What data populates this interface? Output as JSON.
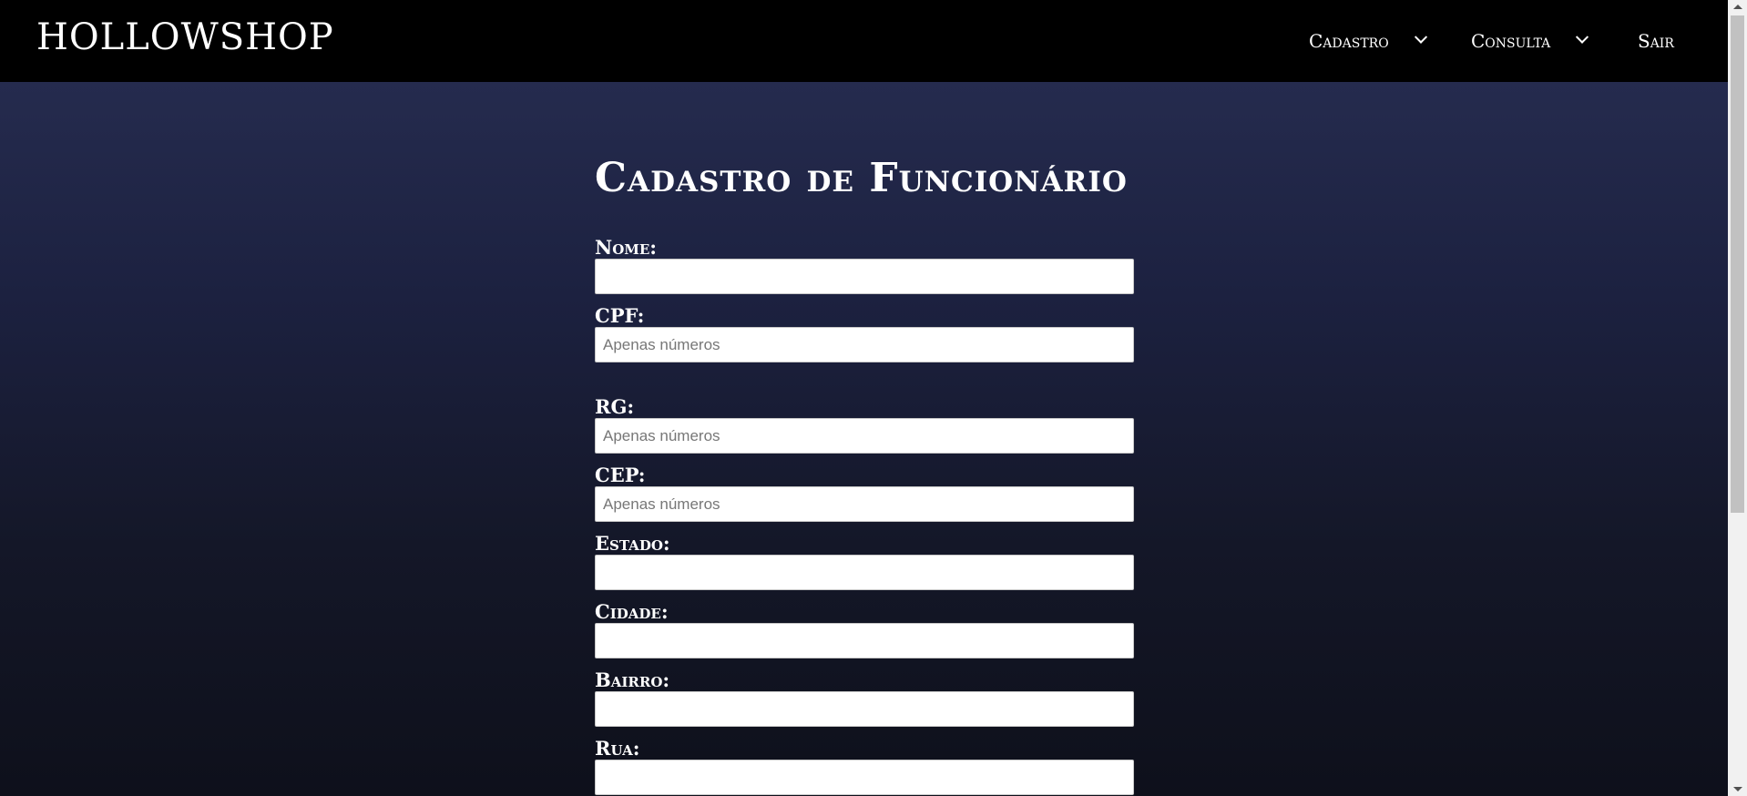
{
  "navbar": {
    "brand": "HOLLOWSHOP",
    "items": [
      {
        "label": "Cadastro",
        "has_dropdown": true
      },
      {
        "label": "Consulta",
        "has_dropdown": true
      },
      {
        "label": "Sair",
        "has_dropdown": false
      }
    ]
  },
  "form": {
    "title": "Cadastro de Funcionário",
    "fields": {
      "nome": {
        "label": "Nome:",
        "value": "",
        "placeholder": ""
      },
      "cpf": {
        "label": "CPF:",
        "value": "",
        "placeholder": "Apenas números"
      },
      "rg": {
        "label": "RG:",
        "value": "",
        "placeholder": "Apenas números"
      },
      "cep": {
        "label": "CEP:",
        "value": "",
        "placeholder": "Apenas números"
      },
      "estado": {
        "label": "Estado:",
        "value": "",
        "placeholder": ""
      },
      "cidade": {
        "label": "Cidade:",
        "value": "",
        "placeholder": ""
      },
      "bairro": {
        "label": "Bairro:",
        "value": "",
        "placeholder": ""
      },
      "rua": {
        "label": "Rua:",
        "value": "",
        "placeholder": ""
      }
    }
  },
  "colors": {
    "navbar_bg": "#000000",
    "gradient_top": "#252b4e",
    "gradient_bottom": "#0e101b",
    "text": "#ffffff"
  }
}
